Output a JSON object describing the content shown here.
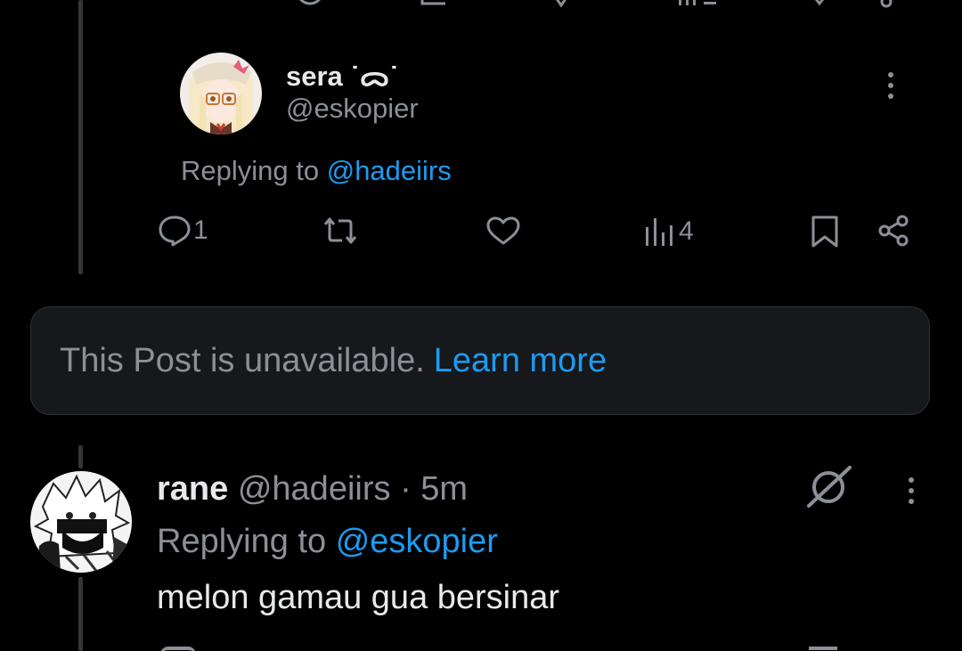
{
  "post1": {
    "display_name": "sera ˙ᯅ˙",
    "handle": "@eskopier",
    "replying_prefix": "Replying to",
    "replying_handle": "@hadeiirs",
    "actions": {
      "reply_count": "1",
      "repost_count": "",
      "like_count": "",
      "views_count": "4"
    }
  },
  "unavailable": {
    "message": "This Post is unavailable.",
    "link": "Learn more"
  },
  "post2": {
    "display_name": "rane",
    "handle": "@hadeiirs",
    "separator": "·",
    "time": "5m",
    "replying_prefix": "Replying to",
    "replying_handle": "@eskopier",
    "body": "melon gamau gua bersinar"
  },
  "colors": {
    "background": "#000000",
    "text": "#e7e9ea",
    "muted": "#8b9096",
    "accent": "#1d9bf0",
    "card": "#16181c"
  },
  "icons": [
    "reply-icon",
    "repost-icon",
    "like-icon",
    "views-icon",
    "bookmark-icon",
    "share-icon",
    "more-icon",
    "grok-icon"
  ]
}
